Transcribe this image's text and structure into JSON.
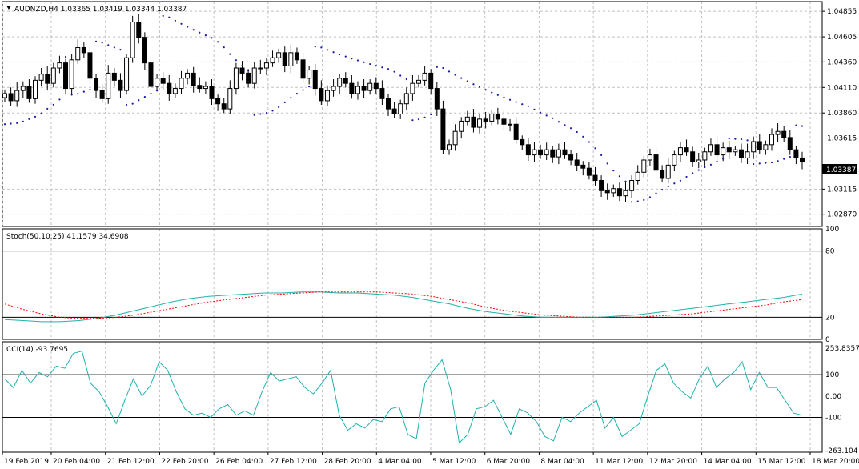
{
  "chart_data": [
    {
      "type": "candlestick",
      "title": "AUDNZD,H4 1.03365 1.03419 1.03344 1.03387",
      "symbol": "AUDNZD",
      "timeframe": "H4",
      "last_price": "1.03387",
      "ylim": [
        1.0275,
        1.0495
      ],
      "y_ticks": [
        "1.04855",
        "1.04605",
        "1.04360",
        "1.04110",
        "1.03860",
        "1.03615",
        "1.03115",
        "1.02870"
      ],
      "x_ticks": [
        "19 Feb 2019",
        "20 Feb 04:00",
        "21 Feb 12:00",
        "22 Feb 20:00",
        "26 Feb 04:00",
        "27 Feb 12:00",
        "28 Feb 20:00",
        "4 Mar 04:00",
        "5 Mar 12:00",
        "6 Mar 20:00",
        "8 Mar 04:00",
        "11 Mar 12:00",
        "12 Mar 20:00",
        "14 Mar 04:00",
        "15 Mar 12:00",
        "18 Mar 20:00"
      ],
      "close": [
        1.0405,
        1.0398,
        1.0408,
        1.0412,
        1.04,
        1.0418,
        1.0424,
        1.0415,
        1.043,
        1.0435,
        1.041,
        1.0438,
        1.045,
        1.0445,
        1.042,
        1.0408,
        1.04,
        1.0425,
        1.0418,
        1.0408,
        1.044,
        1.0475,
        1.046,
        1.0435,
        1.0412,
        1.042,
        1.0415,
        1.0405,
        1.041,
        1.042,
        1.0425,
        1.0413,
        1.041,
        1.0412,
        1.04,
        1.0395,
        1.039,
        1.041,
        1.043,
        1.0425,
        1.0415,
        1.043,
        1.043,
        1.0435,
        1.044,
        1.0445,
        1.0432,
        1.0445,
        1.0438,
        1.042,
        1.0428,
        1.041,
        1.0398,
        1.0408,
        1.0412,
        1.042,
        1.0415,
        1.0405,
        1.0412,
        1.0408,
        1.0415,
        1.041,
        1.04,
        1.039,
        1.0385,
        1.0395,
        1.0405,
        1.0415,
        1.0418,
        1.0425,
        1.041,
        1.039,
        1.035,
        1.0355,
        1.0368,
        1.0378,
        1.0382,
        1.0372,
        1.038,
        1.0378,
        1.0385,
        1.038,
        1.0375,
        1.0375,
        1.036,
        1.0355,
        1.0345,
        1.035,
        1.0345,
        1.035,
        1.0343,
        1.035,
        1.0345,
        1.034,
        1.0335,
        1.0332,
        1.0325,
        1.032,
        1.031,
        1.0308,
        1.0312,
        1.0305,
        1.031,
        1.032,
        1.0328,
        1.034,
        1.0345,
        1.033,
        1.0322,
        1.0335,
        1.0345,
        1.0352,
        1.0348,
        1.0338,
        1.034,
        1.0348,
        1.0355,
        1.0345,
        1.0352,
        1.0348,
        1.035,
        1.0342,
        1.0348,
        1.0358,
        1.035,
        1.0355,
        1.0365,
        1.0368,
        1.0362,
        1.035,
        1.0342,
        1.0338
      ],
      "stoch": {
        "label": "Stoch(50,10,25) 41.1579 34.6908",
        "ylim": [
          0,
          100
        ],
        "ticks": [
          "100",
          "80",
          "20",
          "0"
        ],
        "levels": [
          80,
          20
        ],
        "main_color": "#20b2aa",
        "signal_color": "#ff0000",
        "main": [
          18,
          17,
          16,
          16,
          17,
          19,
          22,
          26,
          30,
          34,
          37,
          39,
          40,
          41,
          42,
          42,
          43,
          43,
          42,
          42,
          41,
          40,
          38,
          35,
          32,
          28,
          25,
          23,
          21,
          20,
          20,
          20,
          20,
          21,
          22,
          24,
          26,
          28,
          30,
          32,
          34,
          36,
          38,
          41
        ],
        "signal": [
          32,
          27,
          23,
          20,
          19,
          19,
          20,
          22,
          25,
          28,
          31,
          34,
          36,
          38,
          40,
          41,
          42,
          43,
          43,
          43,
          43,
          42,
          41,
          39,
          36,
          33,
          29,
          26,
          24,
          22,
          21,
          20,
          20,
          20,
          20,
          21,
          22,
          23,
          25,
          27,
          29,
          31,
          34,
          36
        ]
      },
      "cci": {
        "label": "CCI(14) -93.7695",
        "ylim": [
          -263.104,
          253.8357
        ],
        "ticks": [
          "253.8357",
          "100",
          "0.00",
          "-100",
          "-263.104"
        ],
        "levels": [
          100,
          -100
        ],
        "line_color": "#20b2aa",
        "values": [
          80,
          40,
          120,
          60,
          110,
          90,
          140,
          130,
          200,
          210,
          60,
          20,
          -50,
          -130,
          -20,
          80,
          0,
          50,
          160,
          120,
          20,
          -60,
          -90,
          -80,
          -100,
          -60,
          -40,
          -90,
          -70,
          -90,
          20,
          110,
          70,
          80,
          90,
          40,
          10,
          60,
          120,
          -90,
          -160,
          -130,
          -150,
          -110,
          -120,
          -60,
          -50,
          -180,
          -200,
          60,
          120,
          170,
          30,
          -220,
          -180,
          -60,
          -50,
          -20,
          -100,
          -180,
          -60,
          -80,
          -120,
          -190,
          -210,
          -100,
          -120,
          -80,
          -50,
          -20,
          -150,
          -100,
          -190,
          -160,
          -130,
          0,
          120,
          150,
          60,
          20,
          -10,
          80,
          140,
          40,
          80,
          110,
          160,
          30,
          110,
          40,
          40,
          -20,
          -80,
          -90
        ]
      }
    }
  ]
}
